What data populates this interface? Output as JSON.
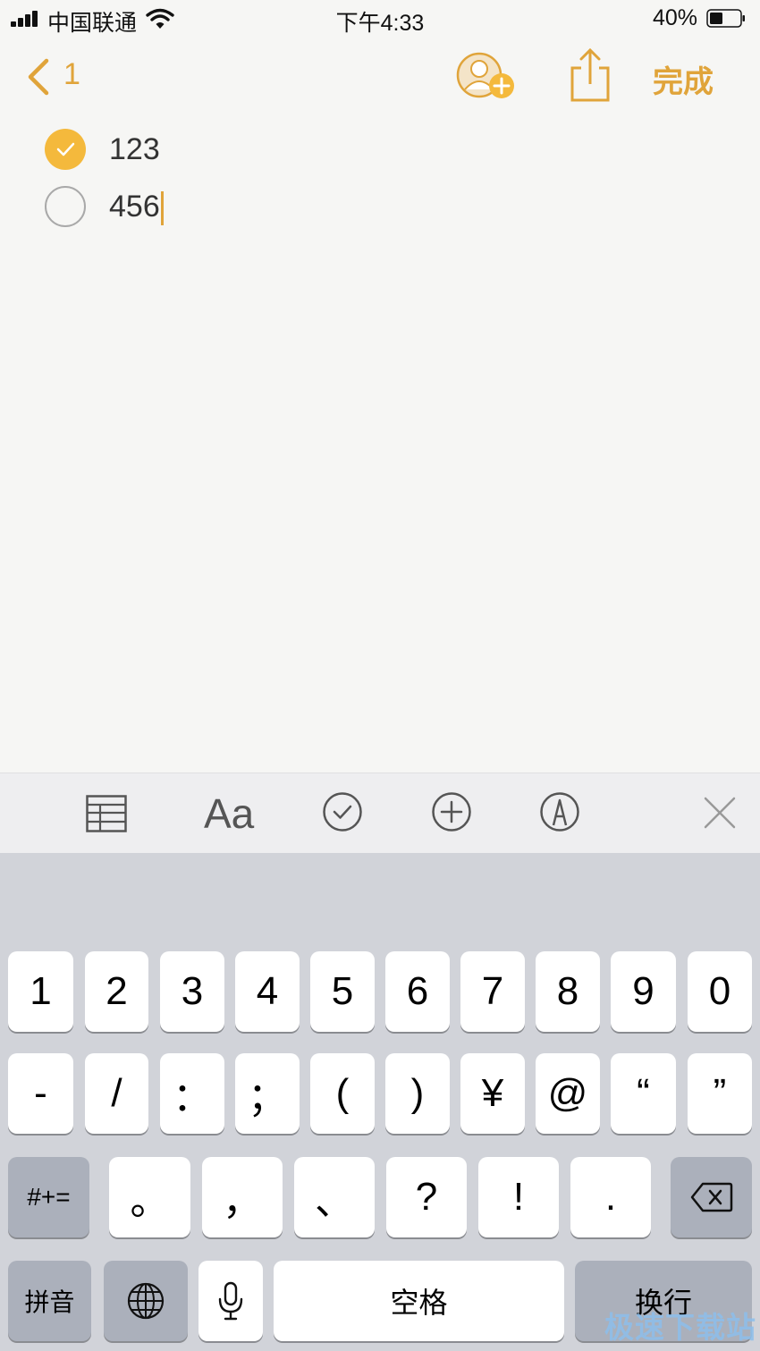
{
  "status_bar": {
    "carrier": "中国联通",
    "time": "下午4:33",
    "battery": "40%"
  },
  "nav": {
    "back_count": "1",
    "done": "完成"
  },
  "checklist": [
    {
      "text": "123",
      "checked": true
    },
    {
      "text": "456",
      "checked": false
    }
  ],
  "toolbar": {
    "format_label": "Aa",
    "icons": [
      "table-icon",
      "text-format-icon",
      "checklist-icon",
      "add-icon",
      "markup-icon",
      "close-icon"
    ]
  },
  "keyboard": {
    "row1": [
      "1",
      "2",
      "3",
      "4",
      "5",
      "6",
      "7",
      "8",
      "9",
      "0"
    ],
    "row2": [
      "-",
      "/",
      "：",
      "；",
      "(",
      ")",
      "¥",
      "@",
      "“",
      "”"
    ],
    "row3": [
      "#+=",
      "。",
      "，",
      "、",
      "?",
      "!",
      ".",
      "delete-icon"
    ],
    "row4": {
      "pinyin": "拼音",
      "space": "空格",
      "return": "换行"
    }
  },
  "watermark": "极速下载站",
  "colors": {
    "accent": "#e0a43a",
    "check_fill": "#f4b93c",
    "keyboard_bg": "#d1d3d9",
    "dark_key": "#abb0bb"
  }
}
